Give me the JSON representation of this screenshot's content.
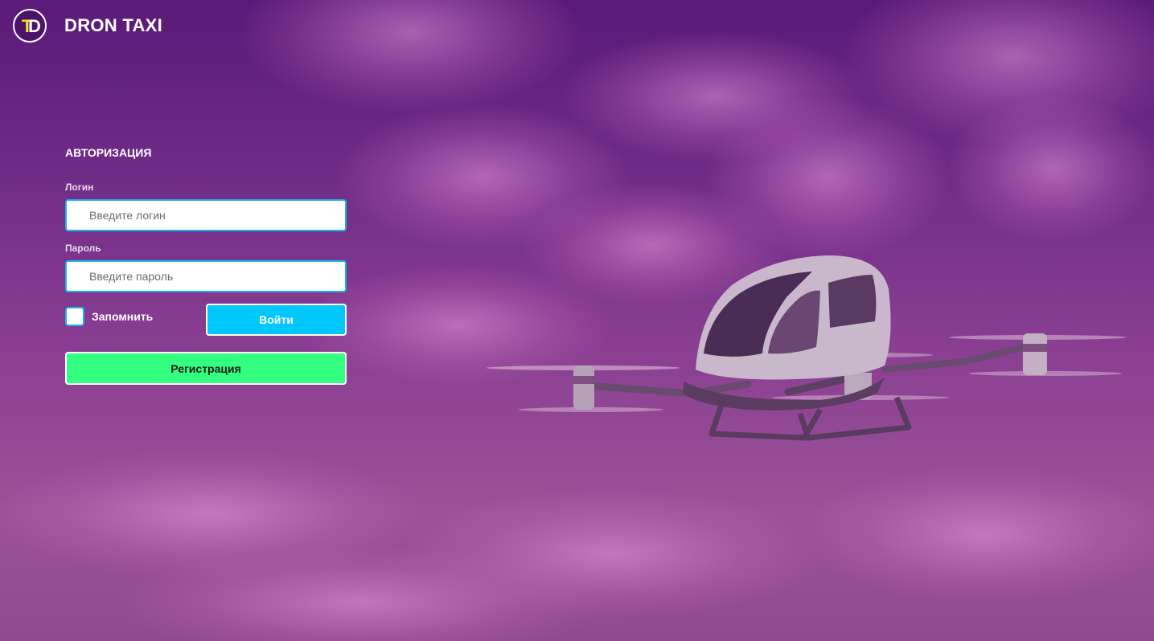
{
  "header": {
    "logo_letters": "TD",
    "brand": "DRON TAXI"
  },
  "auth": {
    "title": "АВТОРИЗАЦИЯ",
    "login_label": "Логин",
    "login_placeholder": "Введите логин",
    "password_label": "Пароль",
    "password_placeholder": "Введите пароль",
    "remember_label": "Запомнить",
    "remember_checked": false,
    "login_button": "Войти",
    "register_button": "Регистрация"
  },
  "colors": {
    "background": "#7a3388",
    "input_border": "#19b3f0",
    "login_button": "#00c8ff",
    "register_button": "#33ff80",
    "logo_accent": "#f2e21a"
  },
  "background_image": {
    "icon": "passenger-drone-illustration"
  }
}
